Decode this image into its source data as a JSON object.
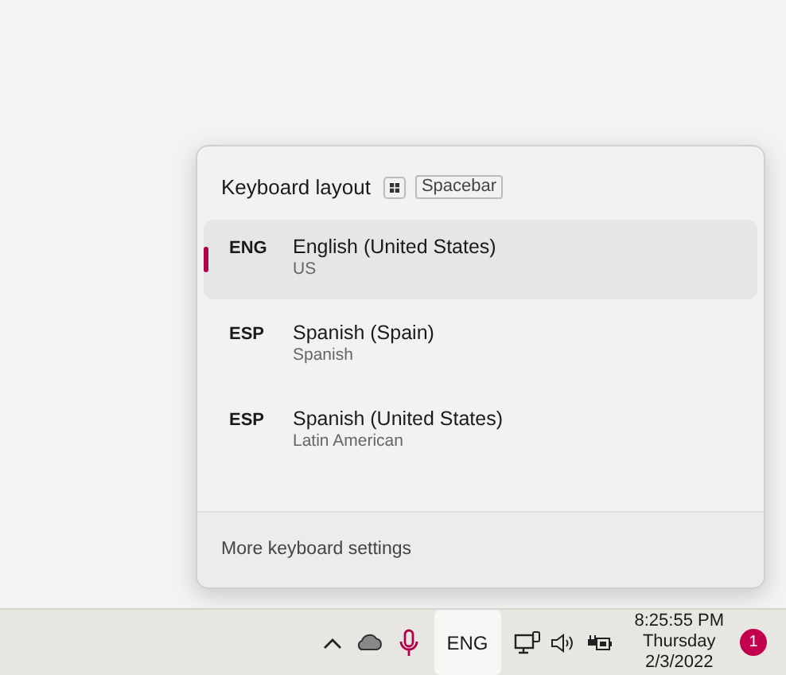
{
  "flyout": {
    "title": "Keyboard layout",
    "shortcut_key": "Spacebar",
    "layouts": [
      {
        "code": "ENG",
        "name": "English (United States)",
        "variant": "US",
        "selected": true
      },
      {
        "code": "ESP",
        "name": "Spanish (Spain)",
        "variant": "Spanish",
        "selected": false
      },
      {
        "code": "ESP",
        "name": "Spanish (United States)",
        "variant": "Latin American",
        "selected": false
      }
    ],
    "footer_link": "More keyboard settings"
  },
  "taskbar": {
    "input_indicator": "ENG",
    "time": "8:25:55 PM",
    "day": "Thursday",
    "date": "2/3/2022",
    "notification_count": "1"
  }
}
